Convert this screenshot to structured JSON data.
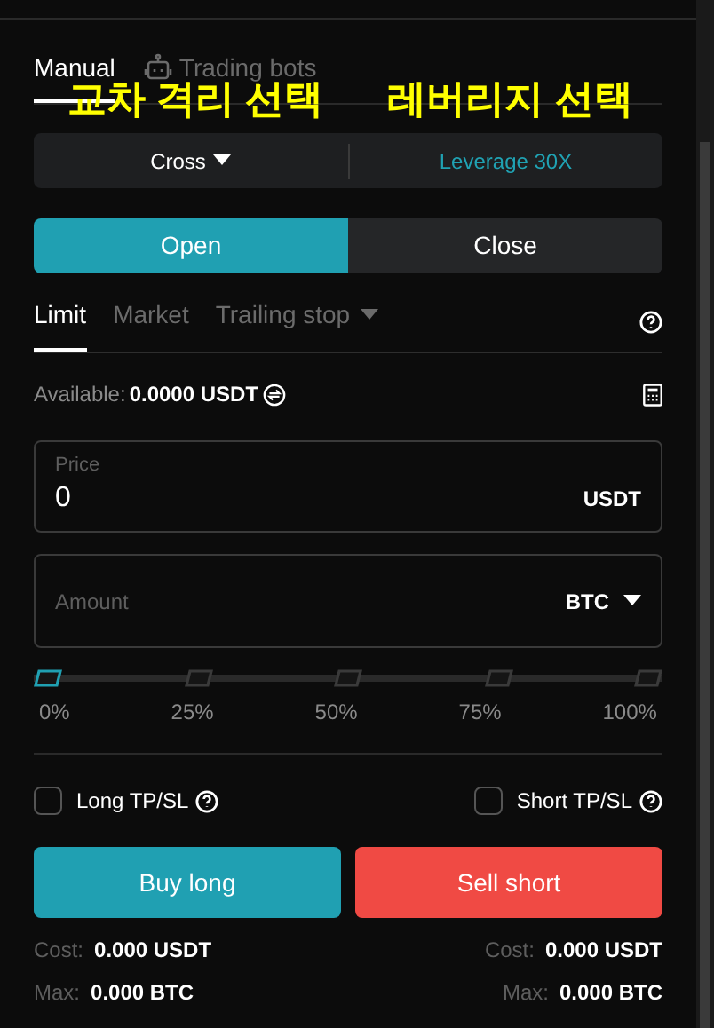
{
  "mode_tabs": [
    {
      "label": "Manual",
      "kind": "text",
      "selected": true
    },
    {
      "label": "Trading bots",
      "kind": "bot",
      "selected": false
    }
  ],
  "annotations": [
    "교차 격리 선택",
    "레버리지 선택"
  ],
  "margin": {
    "mode": "Cross",
    "leverage": "Leverage 30X"
  },
  "sides": [
    {
      "label": "Open",
      "selected": true
    },
    {
      "label": "Close",
      "selected": false
    }
  ],
  "order_types": [
    {
      "label": "Limit",
      "selected": true,
      "dropdown": false
    },
    {
      "label": "Market",
      "selected": false,
      "dropdown": false
    },
    {
      "label": "Trailing stop",
      "selected": false,
      "dropdown": true
    }
  ],
  "available": {
    "label": "Available:",
    "value": "0.0000 USDT"
  },
  "price": {
    "label": "Price",
    "value": "0",
    "unit": "USDT"
  },
  "amount": {
    "placeholder": "Amount",
    "unit": "BTC"
  },
  "slider": {
    "level": 0,
    "marks": [
      "0%",
      "25%",
      "50%",
      "75%",
      "100%"
    ]
  },
  "tpsl": [
    {
      "label": "Long TP/SL",
      "checked": false
    },
    {
      "label": "Short TP/SL",
      "checked": false
    }
  ],
  "actions": [
    {
      "label": "Buy long",
      "kind": "buy"
    },
    {
      "label": "Sell short",
      "kind": "sell"
    }
  ],
  "summary": [
    {
      "cost_label": "Cost:",
      "cost": "0.000 USDT",
      "max_label": "Max:",
      "max": "0.000 BTC"
    },
    {
      "cost_label": "Cost:",
      "cost": "0.000 USDT",
      "max_label": "Max:",
      "max": "0.000 BTC"
    }
  ]
}
